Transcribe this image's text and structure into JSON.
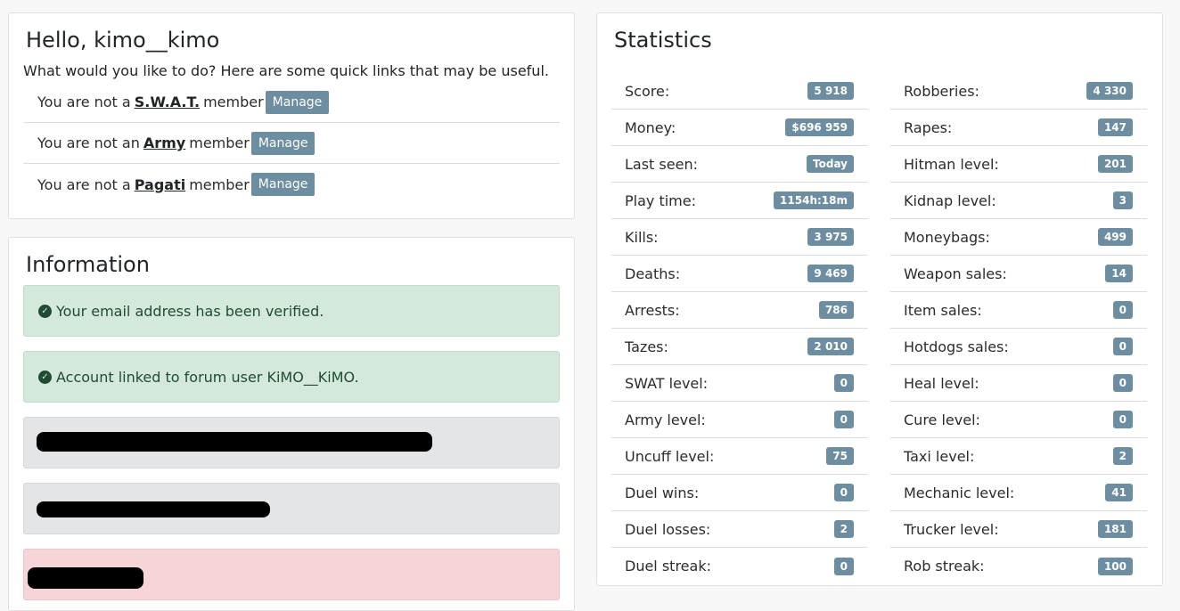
{
  "hello": {
    "title": "Hello, kimo__kimo",
    "intro": "What would you like to do? Here are some quick links that may be useful.",
    "memberships": [
      {
        "prefix": "You are not a",
        "group": "S.W.A.T.",
        "suffix": "member",
        "button": "Manage"
      },
      {
        "prefix": "You are not an",
        "group": "Army",
        "suffix": "member",
        "button": "Manage"
      },
      {
        "prefix": "You are not a",
        "group": "Pagati",
        "suffix": "member",
        "button": "Manage"
      }
    ]
  },
  "information": {
    "title": "Information",
    "alerts": [
      {
        "text": "Your email address has been verified.",
        "type": "success"
      },
      {
        "text": "Account linked to forum user KiMO__KiMO.",
        "type": "success"
      }
    ]
  },
  "statistics": {
    "title": "Statistics",
    "left": [
      {
        "label": "Score:",
        "value": "5 918"
      },
      {
        "label": "Money:",
        "value": "$696 959"
      },
      {
        "label": "Last seen:",
        "value": "Today"
      },
      {
        "label": "Play time:",
        "value": "1154h:18m"
      },
      {
        "label": "Kills:",
        "value": "3 975"
      },
      {
        "label": "Deaths:",
        "value": "9 469"
      },
      {
        "label": "Arrests:",
        "value": "786"
      },
      {
        "label": "Tazes:",
        "value": "2 010"
      },
      {
        "label": "SWAT level:",
        "value": "0"
      },
      {
        "label": "Army level:",
        "value": "0"
      },
      {
        "label": "Uncuff level:",
        "value": "75"
      },
      {
        "label": "Duel wins:",
        "value": "0"
      },
      {
        "label": "Duel losses:",
        "value": "2"
      },
      {
        "label": "Duel streak:",
        "value": "0"
      }
    ],
    "right": [
      {
        "label": "Robberies:",
        "value": "4 330"
      },
      {
        "label": "Rapes:",
        "value": "147"
      },
      {
        "label": "Hitman level:",
        "value": "201"
      },
      {
        "label": "Kidnap level:",
        "value": "3"
      },
      {
        "label": "Moneybags:",
        "value": "499"
      },
      {
        "label": "Weapon sales:",
        "value": "14"
      },
      {
        "label": "Item sales:",
        "value": "0"
      },
      {
        "label": "Hotdogs sales:",
        "value": "0"
      },
      {
        "label": "Heal level:",
        "value": "0"
      },
      {
        "label": "Cure level:",
        "value": "0"
      },
      {
        "label": "Taxi level:",
        "value": "2"
      },
      {
        "label": "Mechanic level:",
        "value": "41"
      },
      {
        "label": "Trucker level:",
        "value": "181"
      },
      {
        "label": "Rob streak:",
        "value": "100"
      }
    ]
  },
  "colors": {
    "badge": "#6c8ea0",
    "success_bg": "#d4e8dc",
    "danger_bg": "#f5d5d8"
  }
}
